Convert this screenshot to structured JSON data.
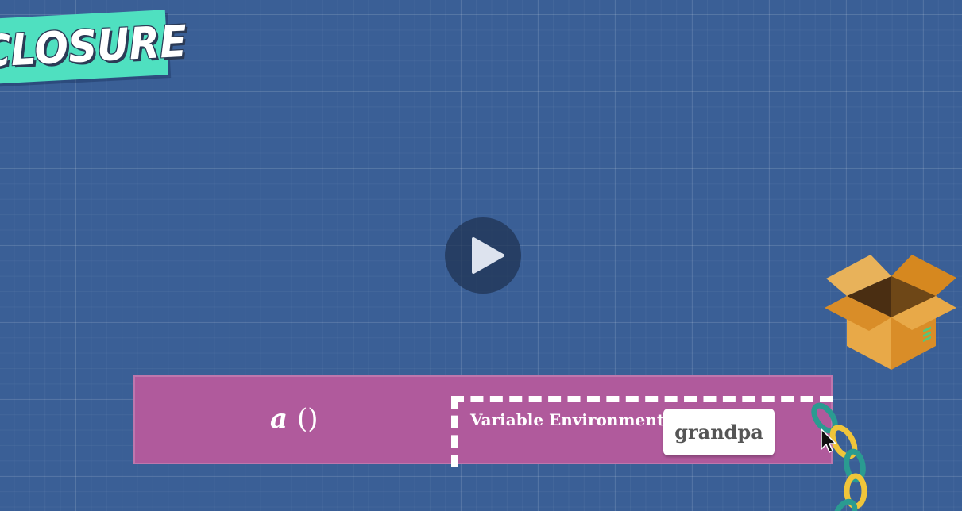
{
  "title": "CLOSURE",
  "player": {
    "play_icon": "play-icon"
  },
  "execution_context": {
    "function_name": "a",
    "parens": "()",
    "variable_environment_label": "Variable Environment",
    "variable": "grandpa"
  },
  "illustrations": {
    "box": "open-box-icon",
    "chain": "chain-icon",
    "cursor": "mouse-cursor-icon"
  },
  "colors": {
    "background": "#3a5f96",
    "banner": "#4fe0c0",
    "context_bar": "#b05a9c",
    "chip": "#ffffff"
  }
}
